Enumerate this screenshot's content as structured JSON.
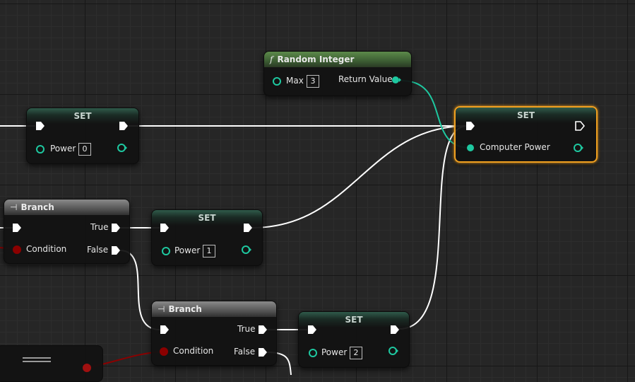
{
  "colors": {
    "exec_wire": "#ffffff",
    "int_wire": "#1ec8a0",
    "bool_wire": "#8b0000",
    "selection": "#f0a020",
    "set_header": "#2e6b58",
    "function_header": "#4f7a40"
  },
  "nodes": {
    "random_integer": {
      "title": "Random Integer",
      "icon": "function-icon",
      "max_label": "Max",
      "max_value": "3",
      "return_label": "Return Value"
    },
    "set_top": {
      "title": "SET",
      "var_label": "Power",
      "var_value": "0"
    },
    "set_selected": {
      "title": "SET",
      "var_label": "Computer Power"
    },
    "branch_1": {
      "title": "Branch",
      "icon": "branch-icon",
      "true_label": "True",
      "condition_label": "Condition",
      "false_label": "False"
    },
    "set_mid": {
      "title": "SET",
      "var_label": "Power",
      "var_value": "1"
    },
    "branch_2": {
      "title": "Branch",
      "icon": "branch-icon",
      "true_label": "True",
      "condition_label": "Condition",
      "false_label": "False"
    },
    "set_low": {
      "title": "SET",
      "var_label": "Power",
      "var_value": "2"
    }
  }
}
